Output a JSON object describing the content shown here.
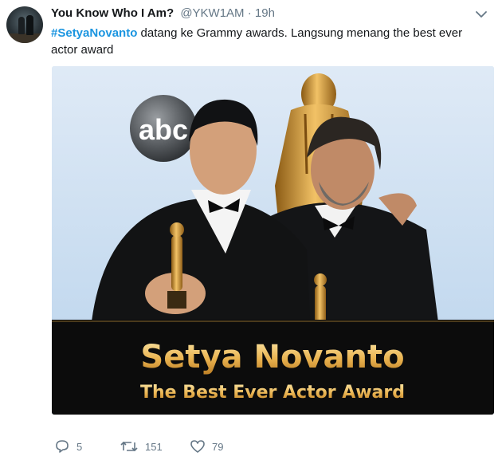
{
  "tweet": {
    "display_name": "You Know Who I Am?",
    "handle": "@YKW1AM",
    "separator": "·",
    "time": "19h",
    "hashtag": "#SetyaNovanto",
    "text": " datang ke Grammy awards. Langsung menang the best ever actor award"
  },
  "media": {
    "logo_text": "abc",
    "caption_title": "Setya Novanto",
    "caption_subtitle": "The Best Ever Actor Award"
  },
  "actions": {
    "reply_count": "5",
    "retweet_count": "151",
    "like_count": "79"
  },
  "icons": {
    "reply": "reply-icon",
    "retweet": "retweet-icon",
    "like": "heart-icon",
    "more": "chevron-down-icon"
  },
  "colors": {
    "link": "#1b95e0",
    "muted": "#657786",
    "gold": "#e7b45a"
  }
}
